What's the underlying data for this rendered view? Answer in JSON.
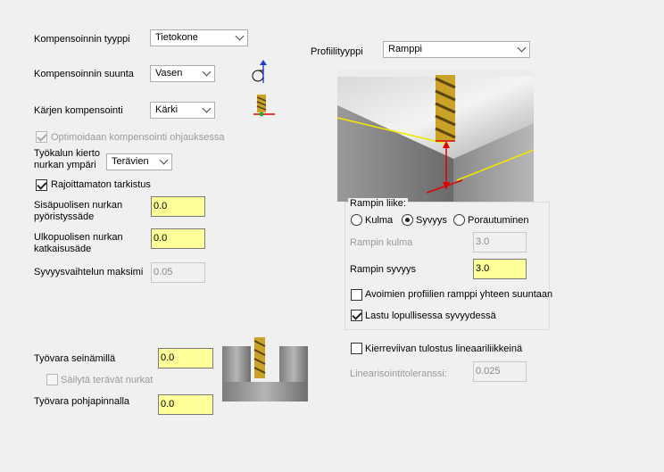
{
  "comp_type": {
    "label": "Kompensoinnin tyyppi",
    "value": "Tietokone"
  },
  "comp_direction": {
    "label": "Kompensoinnin suunta",
    "value": "Vasen"
  },
  "tip_comp": {
    "label": "Kärjen kompensointi",
    "value": "Kärki"
  },
  "optimize_comp": {
    "label": "Optimoidaan kompensointi ohjauksessa",
    "checked": true,
    "enabled": false
  },
  "corner_tool": {
    "label_line1": "Työkalun kierto",
    "label_line2": "nurkan ympäri",
    "value": "Terävien"
  },
  "infinite_check": {
    "label": "Rajoittamaton tarkistus",
    "checked": true
  },
  "inner_corner_radius": {
    "label_line1": "Sisäpuolisen nurkan",
    "label_line2": "pyöristyssäde",
    "value": "0.0"
  },
  "outer_corner_break": {
    "label_line1": "Ulkopuolisen nurkan",
    "label_line2": "katkaisusäde",
    "value": "0.0"
  },
  "max_depth_variation": {
    "label": "Syvyysvaihtelun maksimi",
    "value": "0.05"
  },
  "wall_stock": {
    "label": "Työvara seinämillä",
    "value": "0.0"
  },
  "keep_sharp_corners": {
    "label": "Säilytä terävät nurkat",
    "checked": false,
    "enabled": false
  },
  "floor_stock": {
    "label": "Työvara pohjapinnalla",
    "value": "0.0"
  },
  "profile_type": {
    "label": "Profiilityyppi",
    "value": "Ramppi"
  },
  "ramp_motion": {
    "title": "Rampin liike:",
    "options": [
      {
        "label": "Kulma",
        "selected": false
      },
      {
        "label": "Syvyys",
        "selected": true
      },
      {
        "label": "Porautuminen",
        "selected": false
      }
    ],
    "ramp_angle": {
      "label": "Rampin kulma",
      "value": "3.0",
      "enabled": false
    },
    "ramp_depth": {
      "label": "Rampin syvyys",
      "value": "3.0"
    },
    "open_profiles_one_way": {
      "label": "Avoimien profiilien ramppi yhteen suuntaan",
      "checked": false
    },
    "final_depth_pass": {
      "label": "Lastu lopullisessa syvyydessä",
      "checked": true
    }
  },
  "linearize_helix": {
    "label": "Kierreviivan tulostus lineaariliikkeinä",
    "checked": false
  },
  "linearize_tolerance": {
    "label": "Linearisointitoleranssi:",
    "value": "0.025",
    "enabled": false
  },
  "colors": {
    "input_bg": "#ffff99",
    "window_bg": "#f0f0f0",
    "arrow_red": "#e00000",
    "line_yellow": "#f2e600"
  }
}
